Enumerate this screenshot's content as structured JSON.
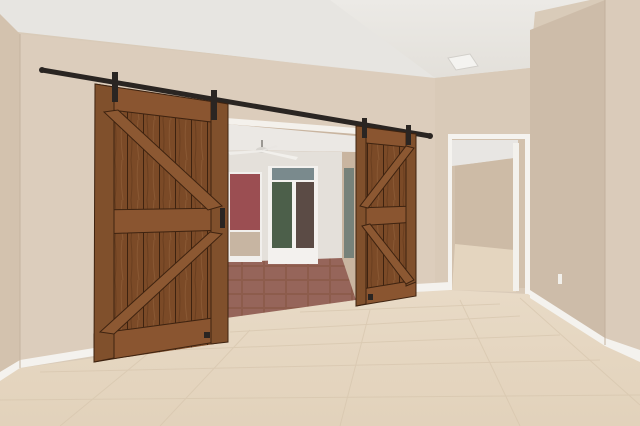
{
  "scene": {
    "description_label": "",
    "colors": {
      "ceiling": "#e9e6e1",
      "wall_left": "#d8c8b6",
      "wall_back": "#dbcdbd",
      "wall_right": "#cfbfad",
      "floor": "#e6d8c3",
      "door_wood": "#7a4a28",
      "door_wood_dark": "#4e2d15",
      "rail": "#2a2522",
      "baseboard": "#f4f2ee",
      "room_floor_tile": "#8a5a4a"
    }
  }
}
